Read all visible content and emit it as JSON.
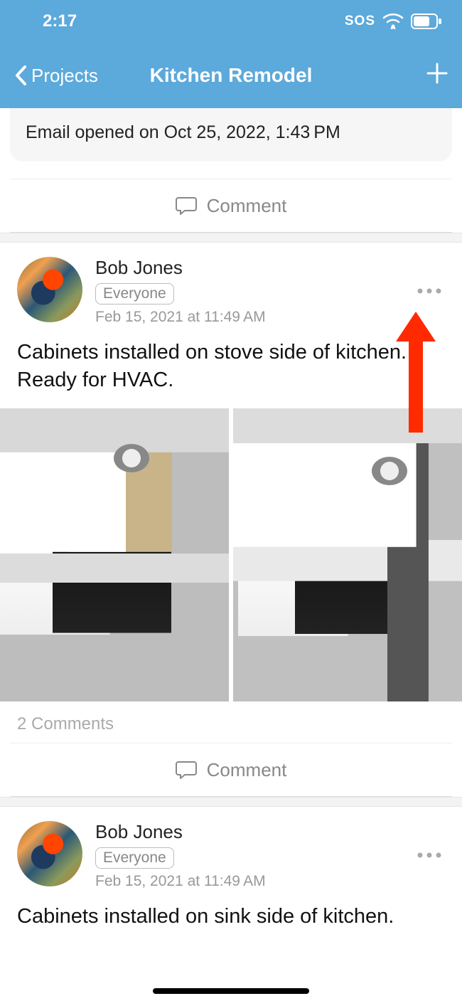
{
  "status": {
    "time": "2:17",
    "sos": "SOS"
  },
  "nav": {
    "back_label": "Projects",
    "title": "Kitchen Remodel"
  },
  "email_notice": "Email opened on Oct 25, 2022, 1:43 PM",
  "comment_action": "Comment",
  "posts": [
    {
      "author": "Bob Jones",
      "audience": "Everyone",
      "timestamp": "Feb 15, 2021 at 11:49 AM",
      "body": "Cabinets installed on stove side of kitchen. Ready for HVAC.",
      "comments_count": "2 Comments"
    },
    {
      "author": "Bob Jones",
      "audience": "Everyone",
      "timestamp": "Feb 15, 2021 at 11:49 AM",
      "body": "Cabinets installed on sink side of kitchen."
    }
  ],
  "annotation": {
    "arrow_color": "#ff2a00"
  }
}
